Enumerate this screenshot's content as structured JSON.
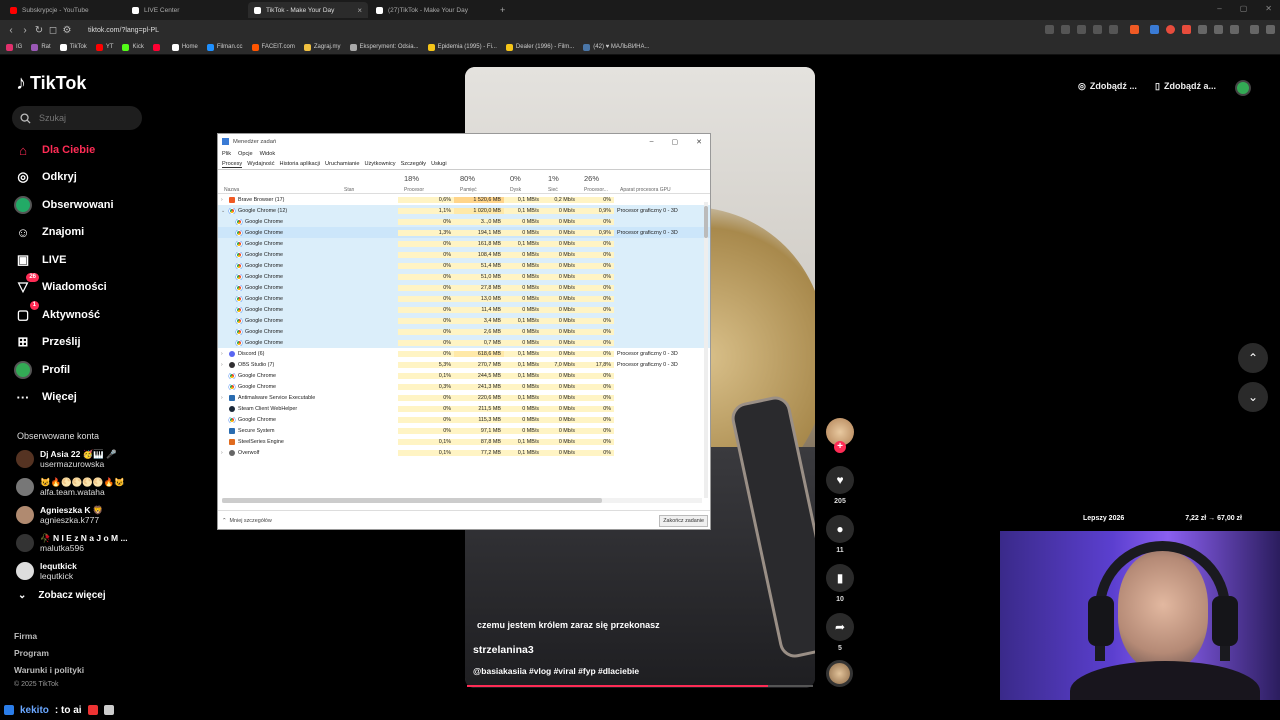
{
  "browser": {
    "tabs": [
      {
        "label": "Subskrypcje - YouTube",
        "favicon_color": "#ff0000"
      },
      {
        "label": "LIVE Center",
        "favicon_color": "#ffffff"
      },
      {
        "label": "TikTok - Make Your Day",
        "favicon_color": "#ffffff"
      },
      {
        "label": "(27)TikTok - Make Your Day",
        "favicon_color": "#ffffff"
      }
    ],
    "new_tab": "+",
    "url": "tiktok.com/?lang=pl-PL",
    "bookmarks": [
      {
        "label": "IG",
        "color": "#e1306c"
      },
      {
        "label": "Rat",
        "color": "#9b59b6"
      },
      {
        "label": "TikTok",
        "color": "#ffffff"
      },
      {
        "label": "YT",
        "color": "#ff0000"
      },
      {
        "label": "Kick",
        "color": "#53fc18"
      },
      {
        "label": "",
        "color": "#ff0033"
      },
      {
        "label": "Home",
        "color": "#ffffff"
      },
      {
        "label": "Filman.cc",
        "color": "#1e90ff"
      },
      {
        "label": "FACEIT.com",
        "color": "#ff5500"
      },
      {
        "label": "Zagraj.my",
        "color": "#f0c040"
      },
      {
        "label": "Eksperyment: Odsia...",
        "color": "#aaaaaa"
      },
      {
        "label": "Epidemia (1995) - Fi...",
        "color": "#f5c518"
      },
      {
        "label": "Dealer (1996) - Film...",
        "color": "#f5c518"
      },
      {
        "label": "(42) ♥ МАЛЬВИНА...",
        "color": "#4a76a8"
      }
    ]
  },
  "tiktok": {
    "logo": "TikTok",
    "search_placeholder": "Szukaj",
    "nav": [
      {
        "label": "Dla Ciebie",
        "icon": "home-icon",
        "glyph": "⌂",
        "active": true
      },
      {
        "label": "Odkryj",
        "icon": "compass-icon",
        "glyph": "◎"
      },
      {
        "label": "Obserwowani",
        "icon": "following-avatar-icon",
        "glyph": "●"
      },
      {
        "label": "Znajomi",
        "icon": "friends-icon",
        "glyph": "☺"
      },
      {
        "label": "LIVE",
        "icon": "live-icon",
        "glyph": "▣"
      },
      {
        "label": "Wiadomości",
        "icon": "inbox-icon",
        "glyph": "▽",
        "badge": "26"
      },
      {
        "label": "Aktywność",
        "icon": "activity-icon",
        "glyph": "▢",
        "badge": "1"
      },
      {
        "label": "Prześlij",
        "icon": "upload-icon",
        "glyph": "⊞"
      },
      {
        "label": "Profil",
        "icon": "profile-avatar-icon",
        "glyph": "●"
      },
      {
        "label": "Więcej",
        "icon": "more-icon",
        "glyph": "···"
      }
    ],
    "followed_title": "Obserwowane konta",
    "followed": [
      {
        "name": "Dj Asia 22 🥳🎹 🎤",
        "user": "usermazurowska",
        "color": "#553322"
      },
      {
        "name": "😺🔥🌕🌕🌕🌕🔥😺",
        "user": "alfa.team.wataha",
        "color": "#777777"
      },
      {
        "name": "Agnieszka K 🦁",
        "user": "agnieszka.k777",
        "color": "#b08a70"
      },
      {
        "name": "🥀 N I E z N a J o M ...",
        "user": "malutka596",
        "color": "#333333"
      },
      {
        "name": "lequtkick",
        "user": "lequtkick",
        "color": "#dddddd"
      }
    ],
    "see_more": "Zobacz więcej",
    "footer": [
      "Firma",
      "Program",
      "Warunki i polityki"
    ],
    "copyright": "© 2025 TikTok",
    "header_buttons": [
      "Zdobądź ...",
      "Zdobądź a..."
    ]
  },
  "video": {
    "caption": "czemu jestem królem zaraz się przekonasz",
    "author": "strzelanina3",
    "tags": "@basiakasiia #vlog #viral #fyp #dlaciebie",
    "progress": 0.87,
    "actions": {
      "likes": "205",
      "comments": "11",
      "saves": "10",
      "shares": "5"
    },
    "accent": "#fe2c55"
  },
  "task_manager": {
    "title": "Menedżer zadań",
    "menu": [
      "Plik",
      "Opcje",
      "Widok"
    ],
    "tabs": [
      "Procesy",
      "Wydajność",
      "Historia aplikacji",
      "Uruchamianie",
      "Użytkownicy",
      "Szczegóły",
      "Usługi"
    ],
    "active_tab": "Procesy",
    "columns": {
      "name": "Nazwa",
      "status": "Stan",
      "cpu_pct": "18%",
      "cpu": "Procesor",
      "mem_pct": "80%",
      "mem": "Pamięć",
      "disk_pct": "0%",
      "disk": "Dysk",
      "net_pct": "1%",
      "net": "Sieć",
      "gpu_pct": "26%",
      "gpu": "Procesor...",
      "gpu_engine": "Aparat procesora GPU"
    },
    "rows": [
      {
        "name": "Brave Browser (17)",
        "icon": "brave",
        "type": "group-collapsed",
        "cpu": "0,6%",
        "mem": "1 520,6 MB",
        "disk": "0,1 MB/s",
        "net": "0,2 Mb/s",
        "gpu": "0%",
        "engine": "",
        "mem_level": "hi"
      },
      {
        "name": "Google Chrome (12)",
        "icon": "chrome",
        "type": "group-expanded",
        "cpu": "1,1%",
        "mem": "1 020,0 MB",
        "disk": "0,1 MB/s",
        "net": "0 Mb/s",
        "gpu": "0,9%",
        "engine": "Procesor graficzny 0 - 3D",
        "mem_level": "md"
      },
      {
        "name": "Google Chrome",
        "icon": "chrome",
        "type": "child",
        "cpu": "0%",
        "mem": "3..,0 MB",
        "disk": "0 MB/s",
        "net": "0 Mb/s",
        "gpu": "0%",
        "engine": ""
      },
      {
        "name": "Google Chrome",
        "icon": "chrome",
        "type": "child-selected",
        "cpu": "1,3%",
        "mem": "194,1 MB",
        "disk": "0 MB/s",
        "net": "0 Mb/s",
        "gpu": "0,9%",
        "engine": "Procesor graficzny 0 - 3D"
      },
      {
        "name": "Google Chrome",
        "icon": "chrome",
        "type": "child",
        "cpu": "0%",
        "mem": "161,8 MB",
        "disk": "0,1 MB/s",
        "net": "0 Mb/s",
        "gpu": "0%",
        "engine": ""
      },
      {
        "name": "Google Chrome",
        "icon": "chrome",
        "type": "child",
        "cpu": "0%",
        "mem": "108,4 MB",
        "disk": "0 MB/s",
        "net": "0 Mb/s",
        "gpu": "0%",
        "engine": ""
      },
      {
        "name": "Google Chrome",
        "icon": "chrome",
        "type": "child",
        "cpu": "0%",
        "mem": "51,4 MB",
        "disk": "0 MB/s",
        "net": "0 Mb/s",
        "gpu": "0%",
        "engine": ""
      },
      {
        "name": "Google Chrome",
        "icon": "chrome",
        "type": "child",
        "cpu": "0%",
        "mem": "51,0 MB",
        "disk": "0 MB/s",
        "net": "0 Mb/s",
        "gpu": "0%",
        "engine": ""
      },
      {
        "name": "Google Chrome",
        "icon": "chrome",
        "type": "child",
        "cpu": "0%",
        "mem": "27,8 MB",
        "disk": "0 MB/s",
        "net": "0 Mb/s",
        "gpu": "0%",
        "engine": ""
      },
      {
        "name": "Google Chrome",
        "icon": "chrome",
        "type": "child",
        "cpu": "0%",
        "mem": "13,0 MB",
        "disk": "0 MB/s",
        "net": "0 Mb/s",
        "gpu": "0%",
        "engine": ""
      },
      {
        "name": "Google Chrome",
        "icon": "chrome",
        "type": "child",
        "cpu": "0%",
        "mem": "11,4 MB",
        "disk": "0 MB/s",
        "net": "0 Mb/s",
        "gpu": "0%",
        "engine": ""
      },
      {
        "name": "Google Chrome",
        "icon": "chrome",
        "type": "child",
        "cpu": "0%",
        "mem": "3,4 MB",
        "disk": "0,1 MB/s",
        "net": "0 Mb/s",
        "gpu": "0%",
        "engine": ""
      },
      {
        "name": "Google Chrome",
        "icon": "chrome",
        "type": "child",
        "cpu": "0%",
        "mem": "2,6 MB",
        "disk": "0 MB/s",
        "net": "0 Mb/s",
        "gpu": "0%",
        "engine": ""
      },
      {
        "name": "Google Chrome",
        "icon": "chrome",
        "type": "child",
        "cpu": "0%",
        "mem": "0,7 MB",
        "disk": "0 MB/s",
        "net": "0 Mb/s",
        "gpu": "0%",
        "engine": ""
      },
      {
        "name": "Discord (6)",
        "icon": "discord",
        "type": "group-collapsed",
        "cpu": "0%",
        "mem": "618,6 MB",
        "disk": "0,1 MB/s",
        "net": "0 Mb/s",
        "gpu": "0%",
        "engine": "Procesor graficzny 0 - 3D",
        "mem_level": "md"
      },
      {
        "name": "OBS Studio (7)",
        "icon": "obs",
        "type": "group-collapsed",
        "cpu": "5,3%",
        "mem": "270,7 MB",
        "disk": "0,1 MB/s",
        "net": "7,0 Mb/s",
        "gpu": "17,8%",
        "engine": "Procesor graficzny 0 - 3D"
      },
      {
        "name": "Google Chrome",
        "icon": "chrome",
        "type": "app",
        "cpu": "0,1%",
        "mem": "244,5 MB",
        "disk": "0,1 MB/s",
        "net": "0 Mb/s",
        "gpu": "0%",
        "engine": ""
      },
      {
        "name": "Google Chrome",
        "icon": "chrome",
        "type": "app",
        "cpu": "0,3%",
        "mem": "241,3 MB",
        "disk": "0 MB/s",
        "net": "0 Mb/s",
        "gpu": "0%",
        "engine": ""
      },
      {
        "name": "Antimalware Service Executable",
        "icon": "shield",
        "type": "group-collapsed",
        "cpu": "0%",
        "mem": "220,6 MB",
        "disk": "0,1 MB/s",
        "net": "0 Mb/s",
        "gpu": "0%",
        "engine": ""
      },
      {
        "name": "Steam Client WebHelper",
        "icon": "steam",
        "type": "app",
        "cpu": "0%",
        "mem": "211,5 MB",
        "disk": "0 MB/s",
        "net": "0 Mb/s",
        "gpu": "0%",
        "engine": ""
      },
      {
        "name": "Google Chrome",
        "icon": "chrome",
        "type": "app",
        "cpu": "0%",
        "mem": "115,3 MB",
        "disk": "0 MB/s",
        "net": "0 Mb/s",
        "gpu": "0%",
        "engine": ""
      },
      {
        "name": "Secure System",
        "icon": "shield",
        "type": "app",
        "cpu": "0%",
        "mem": "97,1 MB",
        "disk": "0 MB/s",
        "net": "0 Mb/s",
        "gpu": "0%",
        "engine": ""
      },
      {
        "name": "SteelSeries Engine",
        "icon": "ss",
        "type": "app",
        "cpu": "0,1%",
        "mem": "87,8 MB",
        "disk": "0,1 MB/s",
        "net": "0 Mb/s",
        "gpu": "0%",
        "engine": ""
      },
      {
        "name": "Overwolf",
        "icon": "ow",
        "type": "group-collapsed",
        "cpu": "0,1%",
        "mem": "77,2 MB",
        "disk": "0,1 MB/s",
        "net": "0 Mb/s",
        "gpu": "0%",
        "engine": ""
      }
    ],
    "fewer_details": "Mniej szczegółów",
    "end_task": "Zakończ zadanie"
  },
  "stream": {
    "overlay_left": "Lepszy 2026",
    "overlay_right": "7,22 zł → 67,00 zł",
    "chat_user": "kekito",
    "chat_msg": ": to ai"
  }
}
